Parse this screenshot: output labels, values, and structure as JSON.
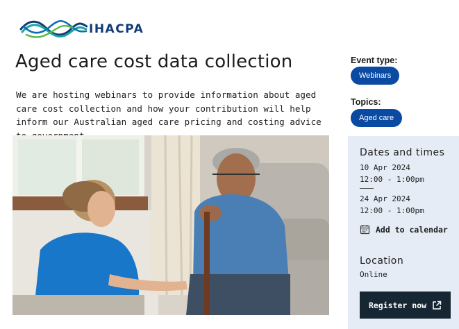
{
  "brand": {
    "name": "IHACPA",
    "colors": {
      "navy": "#123a78",
      "teal": "#19a89c",
      "blue": "#0b4aa2",
      "green": "#58b947"
    }
  },
  "page": {
    "title": "Aged care cost data collection",
    "intro": "We are hosting webinars to provide information about aged care cost collection and how your contribution will help inform our Australian aged care pricing and costing advice to government."
  },
  "hero_image": {
    "icon": "photo-nurse-with-elderly-man"
  },
  "event": {
    "type_label": "Event type:",
    "type_value": "Webinars",
    "topics_label": "Topics:",
    "topic_value": "Aged care",
    "pill_color": "#0b4aa2"
  },
  "schedule": {
    "heading": "Dates and times",
    "sessions": [
      {
        "date": "10 Apr 2024",
        "time": "12:00 - 1:00pm"
      },
      {
        "date": "24 Apr 2024",
        "time": "12:00 - 1:00pm"
      }
    ],
    "add_to_calendar": "Add to calendar",
    "calendar_icon": "calendar-icon",
    "panel_color": "#e6ecf5"
  },
  "location": {
    "heading": "Location",
    "value": "Online"
  },
  "register": {
    "label": "Register now",
    "icon": "external-link-icon",
    "color": "#162633"
  }
}
